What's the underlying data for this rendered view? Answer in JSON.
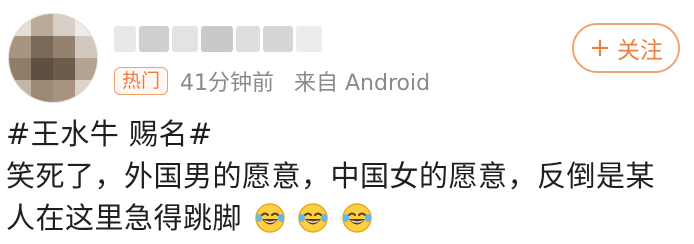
{
  "post": {
    "username_censored": true,
    "badge_label": "热门",
    "time_text": "41分钟前",
    "source_text": "来自 Android",
    "follow_label": "关注",
    "follow_icon": "plus-icon",
    "hashtags": "#王水牛 赐名#",
    "text_line_1": "笑死了，外国男的愿意，中国女的愿意，反倒是某",
    "text_line_2": "人在这里急得跳脚",
    "emojis": [
      "laughing-tears-emoji",
      "laughing-tears-emoji",
      "laughing-tears-emoji"
    ]
  },
  "colors": {
    "accent": "#ef7f3e",
    "meta_text": "#8a8a8a",
    "body_text": "#1f1f1f"
  }
}
